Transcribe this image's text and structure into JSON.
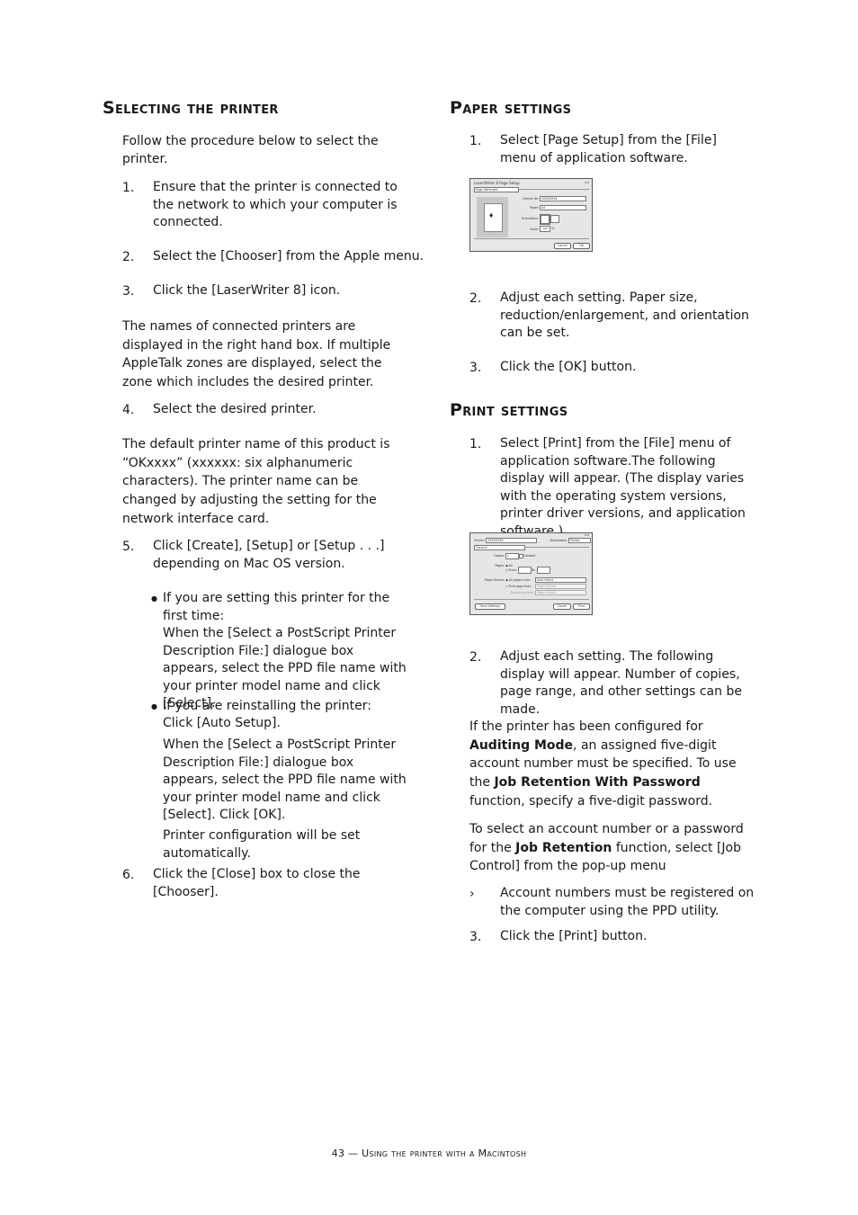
{
  "left": {
    "heading": "Selecting the printer",
    "intro": "Follow the procedure below to select the printer.",
    "step1": {
      "num": "1.",
      "text": "Ensure that the printer is connected to the network to which your computer is connected."
    },
    "step2": {
      "num": "2.",
      "text": "Select the [Chooser] from the Apple menu."
    },
    "step3": {
      "num": "3.",
      "text": "Click the [LaserWriter 8] icon."
    },
    "para1": "The names of connected printers are displayed in the right hand box. If multiple AppleTalk zones are displayed, select the zone which includes the desired printer.",
    "step4": {
      "num": "4.",
      "text": "Select the desired printer."
    },
    "para2": "The default printer name of this product is “OKxxxx” (xxxxxx: six alphanumeric characters). The printer name can be changed by adjusting the setting for the network interface card.",
    "step5": {
      "num": "5.",
      "text": "Click [Create], [Setup] or [Setup . . .] depending on Mac OS version."
    },
    "bullet1": {
      "marker": "●",
      "line1": "If you are setting this printer for the first time:",
      "line2": "When the [Select a PostScript Printer Description  File:] dialogue box appears, select the PPD file name with your printer model name and click [Select]."
    },
    "bullet2": {
      "marker": "●",
      "line1": "If you are reinstalling the printer:",
      "line2": "Click [Auto Setup].",
      "para_a": "When the [Select a PostScript Printer Description File:] dialogue box appears, select the PPD file name with your printer model name and click [Select]. Click [OK].",
      "para_b": "Printer configuration will be set automatically."
    },
    "step6": {
      "num": "6.",
      "text": "Click the [Close] box to close the [Chooser]."
    }
  },
  "right": {
    "paper_heading": "Paper settings",
    "paper_step1": {
      "num": "1.",
      "text": "Select [Page Setup] from the [File] menu of application software."
    },
    "page_setup_dialog": {
      "title": "LaserWriter 8 Page Setup",
      "version": "8.6",
      "menu": "Page Attributes",
      "format_label": "Format for:",
      "format_value": "OKXXXXXX",
      "paper_label": "Paper:",
      "paper_value": "A4",
      "orientation_label": "Orientation:",
      "scale_label": "Scale:",
      "scale_value": "100",
      "scale_unit": "%",
      "cancel": "Cancel",
      "ok": "OK"
    },
    "paper_step2": {
      "num": "2.",
      "text": "Adjust each setting. Paper size, reduction/enlargement, and orientation can be set."
    },
    "paper_step3": {
      "num": "3.",
      "text": "Click the [OK] button."
    },
    "print_heading": "Print settings",
    "print_step1": {
      "num": "1.",
      "text": "Select [Print] from the [File] menu of application software.The following display will appear. (The display varies with the operating system versions, printer driver versions, and application software.)"
    },
    "print_dialog": {
      "printer_label": "Printer:",
      "printer_value": "OKXXXXXX",
      "destination_label": "Destination:",
      "destination_value": "Printer",
      "version": "8.6",
      "menu": "General",
      "copies_label": "Copies:",
      "copies_value": "1",
      "collated": "Collated",
      "pages_label": "Pages:",
      "all": "All",
      "from": "From:",
      "to": "To:",
      "paper_source_label": "Paper Source:",
      "all_pages_from": "All pages from:",
      "auto_select": "Auto Select",
      "first_page_from": "First page from:",
      "remaining_from": "Remaining from:",
      "paper_variant": "Paper Variant",
      "save_settings": "Save Settings",
      "cancel": "Cancel",
      "print": "Print"
    },
    "print_step2": {
      "num": "2.",
      "text": "Adjust each setting. The following display will appear. Number of copies, page range, and other settings can be made."
    },
    "auditing_para": {
      "t1": "If the printer has been configured for ",
      "b1": "Auditing Mode",
      "t2": ", an assigned five-digit account number must be specified. To use the ",
      "b2": "Job Retention With Password",
      "t3": " function, specify a five-digit password."
    },
    "job_para": {
      "t1": "To select an account number or a password for the ",
      "b1": "Job Retention",
      "t2": " function, select [Job Control] from the pop-up menu"
    },
    "note": {
      "marker": "›",
      "text": "Account numbers must be registered on the computer using the PPD utility."
    },
    "print_step3": {
      "num": "3.",
      "text": "Click the [Print] button."
    }
  },
  "footer": "43 — Using the printer with a Macintosh"
}
